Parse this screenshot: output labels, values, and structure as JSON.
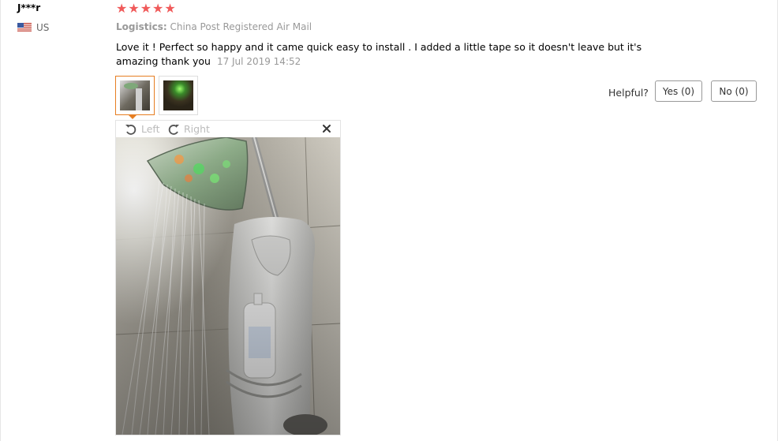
{
  "review": {
    "user_name": "J***r",
    "country_code": "US",
    "rating": 5,
    "stars": [
      "★",
      "★",
      "★",
      "★",
      "★"
    ],
    "logistics_label": "Logistics:",
    "logistics_value": "China Post Registered Air Mail",
    "text": "Love it ! Perfect so happy and it came quick easy to install . I added a little tape so it doesn't leave but it's amazing thank you",
    "date": "17 Jul 2019 14:52"
  },
  "helpful": {
    "label": "Helpful?",
    "yes_label": "Yes (0)",
    "no_label": "No (0)"
  },
  "viewer": {
    "rotate_left_label": "Left",
    "rotate_right_label": "Right",
    "close_icon": "close-icon"
  },
  "colors": {
    "star": "#f05a5a",
    "selected_border": "#e67e22",
    "muted_text": "#999999"
  }
}
